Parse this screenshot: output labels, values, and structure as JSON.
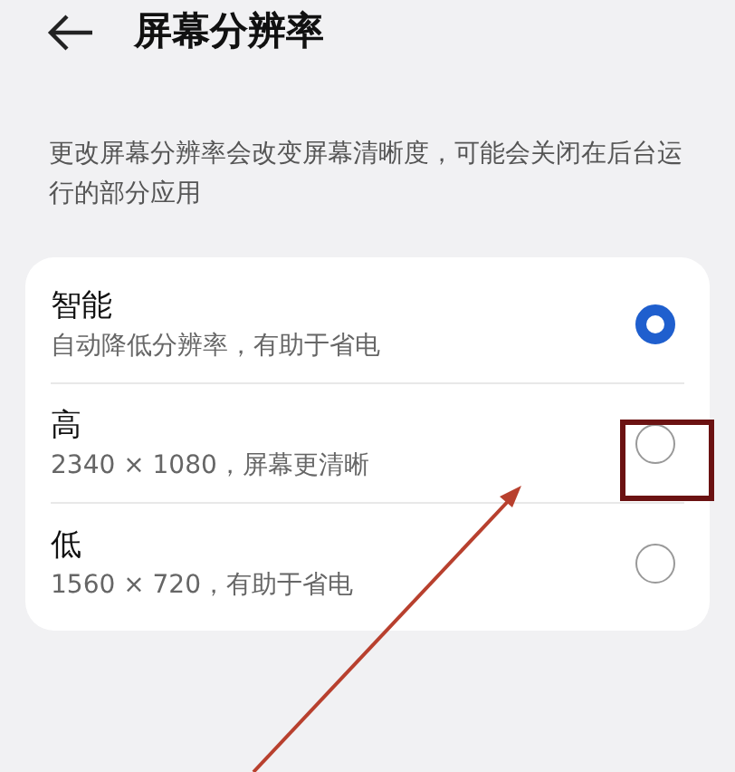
{
  "header": {
    "title": "屏幕分辨率"
  },
  "description": "更改屏幕分辨率会改变屏幕清晰度，可能会关闭在后台运行的部分应用",
  "options": [
    {
      "label": "智能",
      "detail": "自动降低分辨率，有助于省电",
      "selected": true
    },
    {
      "label": "高",
      "detail": "2340 × 1080，屏幕更清晰",
      "selected": false
    },
    {
      "label": "低",
      "detail": "1560 × 720，有助于省电",
      "selected": false
    }
  ]
}
